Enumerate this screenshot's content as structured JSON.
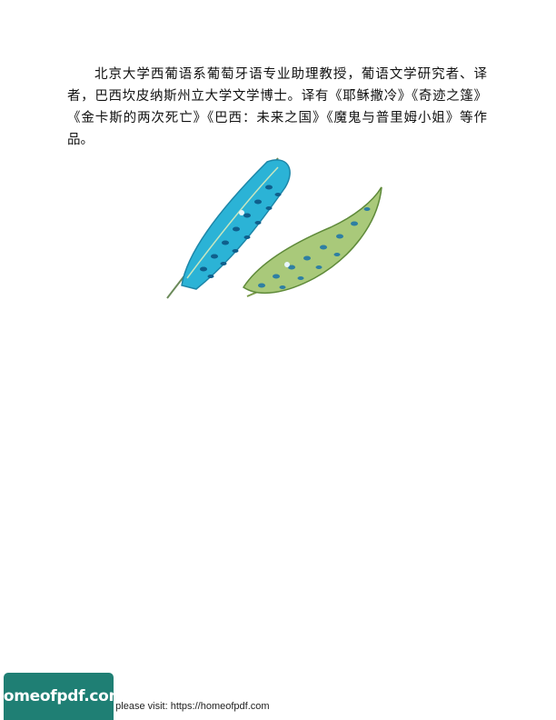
{
  "bio": {
    "text": "北京大学西葡语系葡萄牙语专业助理教授，葡语文学研究者、译者，巴西坎皮纳斯州立大学文学博士。译有《耶稣撒冷》《奇迹之篷》《金卡斯的两次死亡》《巴西：未来之国》《魔鬼与普里姆小姐》等作品。"
  },
  "footer": {
    "visit_text": "e please visit: https://homeofpdf.com",
    "badge_text": "homeofpdf.com"
  },
  "colors": {
    "feather_blue": "#2bb3d6",
    "feather_green": "#a9c97a"
  }
}
